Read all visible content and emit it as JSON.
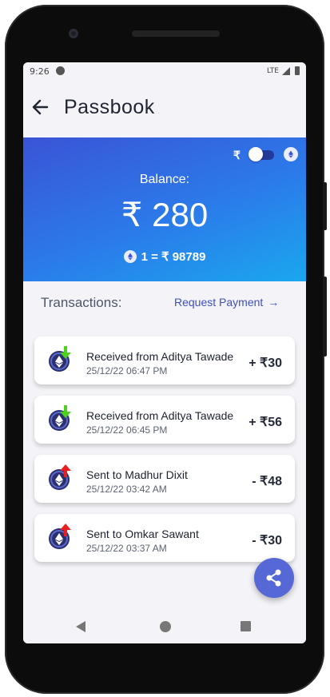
{
  "status": {
    "time": "9:26",
    "network": "LTE"
  },
  "appbar": {
    "title": "Passbook"
  },
  "balance": {
    "toggle_currency_symbol": "₹",
    "label": "Balance:",
    "amount": "₹ 280",
    "rate": "1 = ₹ 98789"
  },
  "transactions": {
    "heading": "Transactions:",
    "request_label": "Request Payment",
    "request_arrow": "→",
    "items": [
      {
        "title": "Received from Aditya Tawade",
        "date": "25/12/22 06:47 PM",
        "amount": "+ ₹30",
        "direction": "received"
      },
      {
        "title": "Received from Aditya Tawade",
        "date": "25/12/22 06:45 PM",
        "amount": "+ ₹56",
        "direction": "received"
      },
      {
        "title": "Sent to Madhur Dixit",
        "date": "25/12/22 03:42 AM",
        "amount": "- ₹48",
        "direction": "sent"
      },
      {
        "title": "Sent to Omkar Sawant",
        "date": "25/12/22 03:37 AM",
        "amount": "- ₹30",
        "direction": "sent"
      }
    ]
  },
  "colors": {
    "hero_start": "#3a54d6",
    "hero_end": "#1aa7ee",
    "received_arrow": "#4cd11c",
    "sent_arrow": "#e81f1f",
    "accent": "#3b4fc4",
    "fab": "#5668d6"
  },
  "icons": {
    "back": "arrow-left-icon",
    "eth": "ethereum-icon",
    "received": "arrow-down-green-icon",
    "sent": "arrow-up-red-icon",
    "share": "share-icon"
  }
}
